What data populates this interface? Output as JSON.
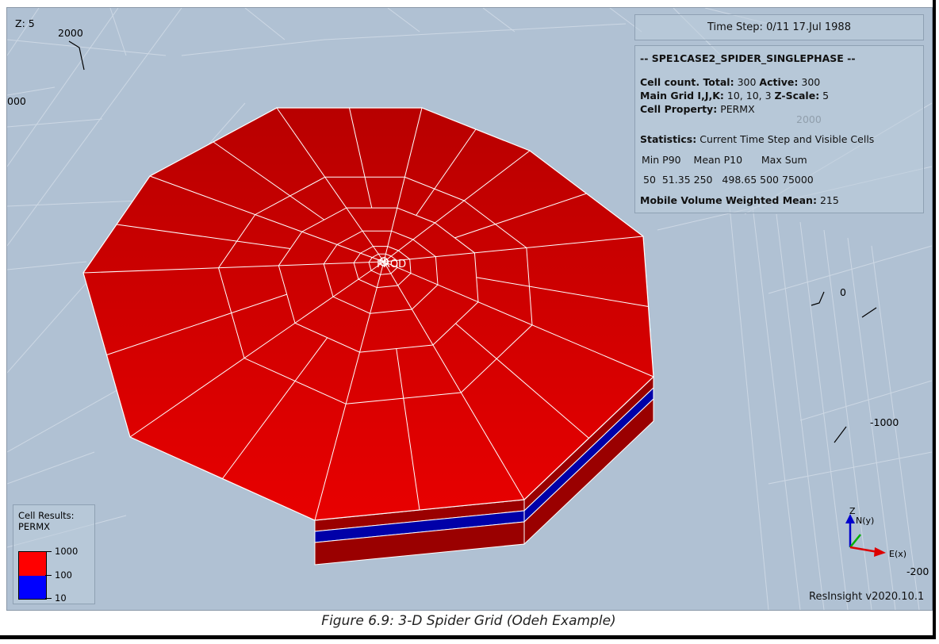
{
  "viewer": {
    "z_scale_label": "Z: 5",
    "time_step": "Time Step: 0/11 17.Jul 1988",
    "case_title": "-- SPE1CASE2_SPIDER_SINGLEPHASE --",
    "cell_count_label": "Cell count. Total:",
    "cell_count_total": "300",
    "active_label": "Active:",
    "active_value": "300",
    "main_grid_label": "Main Grid I,J,K:",
    "main_grid_value": "10, 10, 3",
    "z_scale_info_label": "Z-Scale:",
    "z_scale_value": "5",
    "cell_property_label": "Cell Property:",
    "cell_property_value": "PERMX",
    "statistics_label": "Statistics:",
    "statistics_value": "Current Time Step and Visible Cells",
    "stats_headers": [
      "Min",
      "P90",
      "Mean",
      "P10",
      "Max",
      "Sum"
    ],
    "stats_values": [
      "50",
      "51.35",
      "250",
      "498.65",
      "500",
      "75000"
    ],
    "mobile_volume_label": "Mobile Volume Weighted Mean:",
    "mobile_volume_value": "215",
    "well_label": "PROD",
    "version": "ResInsight v2020.10.1"
  },
  "axes": {
    "labels": [
      "2000",
      "000",
      "2000",
      "0",
      "-1000",
      "-200"
    ]
  },
  "legend": {
    "title_line1": "Cell Results:",
    "title_line2": "PERMX",
    "ticks": [
      "1000",
      "100",
      "10"
    ],
    "colors": [
      "#ff0000",
      "#0000ff"
    ]
  },
  "orientation": {
    "z_label": "Z",
    "n_label": "N(y)",
    "e_label": "E(x)"
  },
  "colors": {
    "background": "#b0c1d3",
    "top_face": "#dd0000",
    "dark_face": "#9a0000",
    "blue_layer": "#0000a8"
  },
  "caption": "Figure 6.9: 3-D Spider Grid (Odeh Example)"
}
